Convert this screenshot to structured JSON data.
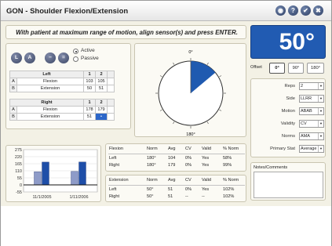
{
  "window": {
    "title": "GON - Shoulder Flexion/Extension",
    "title_buttons": [
      "record-icon",
      "help-icon",
      "check-icon",
      "close-icon"
    ],
    "title_glyphs": [
      "◉",
      "?",
      "✔",
      "✖"
    ]
  },
  "instruction": "With patient at maximum range of motion, align sensor(s) and press ENTER.",
  "current_value": "50°",
  "mode": {
    "buttons": [
      "L",
      "A"
    ],
    "toggles": [
      "minus",
      "equals"
    ],
    "options": [
      "Active",
      "Passive"
    ],
    "selected": "Active"
  },
  "left_table": {
    "title": "Left",
    "col_headers": [
      "1",
      "2"
    ],
    "rows": [
      {
        "idx": "A",
        "label": "Flexion",
        "v1": "103",
        "v2": "105"
      },
      {
        "idx": "B",
        "label": "Extension",
        "v1": "50",
        "v2": "51"
      }
    ]
  },
  "right_table": {
    "title": "Right",
    "col_headers": [
      "1",
      "2"
    ],
    "rows": [
      {
        "idx": "A",
        "label": "Flexion",
        "v1": "178",
        "v2": "179"
      },
      {
        "idx": "B",
        "label": "Extension",
        "v1": "51",
        "v2": "•"
      }
    ]
  },
  "dial": {
    "top_label": "0°",
    "bottom_label": "180°",
    "angle": 50,
    "colors": {
      "sector": "#1f5ab0",
      "face": "#ffffff"
    }
  },
  "offset": {
    "label": "Offset",
    "options": [
      "0°",
      "90°",
      "180°"
    ],
    "selected": "0°"
  },
  "settings": [
    {
      "label": "Reps",
      "value": "2"
    },
    {
      "label": "Side",
      "value": "LLRR"
    },
    {
      "label": "Motion",
      "value": "ABAB"
    },
    {
      "label": "Validity",
      "value": "CV"
    },
    {
      "label": "Norms",
      "value": "AMA"
    },
    {
      "label": "Primary Stat",
      "value": "Average"
    }
  ],
  "notes": {
    "title": "Notes/Comments",
    "value": ""
  },
  "chart_data": {
    "type": "bar",
    "categories": [
      "11/1/2005",
      "1/11/2006"
    ],
    "series": [
      {
        "values": [
          103,
          105
        ],
        "color": "#8e9bc8"
      },
      {
        "values": [
          178,
          179
        ],
        "color": "#1e4ea8"
      }
    ],
    "y_ticks": [
      "275",
      "220",
      "165",
      "110",
      "55",
      "0",
      "-55"
    ],
    "ylim": [
      -55,
      275
    ],
    "reference_line": 0
  },
  "stats": {
    "flexion": {
      "headers": [
        "Flexion",
        "Norm",
        "Avg",
        "CV",
        "Valid",
        "% Norm"
      ],
      "rows": [
        [
          "Left",
          "180°",
          "104",
          "0%",
          "Yes",
          "58%"
        ],
        [
          "Right",
          "180°",
          "179",
          "0%",
          "Yes",
          "99%"
        ]
      ]
    },
    "extension": {
      "headers": [
        "Extension",
        "Norm",
        "Avg",
        "CV",
        "Valid",
        "% Norm"
      ],
      "rows": [
        [
          "Left",
          "50°",
          "51",
          "0%",
          "Yes",
          "102%"
        ],
        [
          "Right",
          "50°",
          "51",
          "--",
          "--",
          "102%"
        ]
      ]
    }
  }
}
